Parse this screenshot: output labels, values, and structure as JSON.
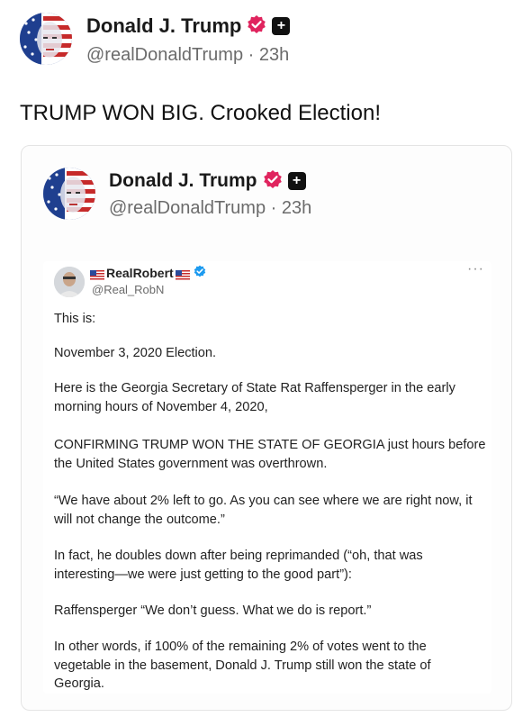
{
  "post": {
    "author_name": "Donald J. Trump",
    "handle": "@realDonaldTrump · 23h",
    "badge_glyph": "+",
    "text": "TRUMP WON BIG. Crooked Election!"
  },
  "quoted_post": {
    "author_name": "Donald J. Trump",
    "handle": "@realDonaldTrump · 23h",
    "badge_glyph": "+"
  },
  "embedded_tweet": {
    "author_name": "RealRobert",
    "handle": "@Real_RobN",
    "more_glyph": "···",
    "lines": [
      "This is:",
      "November 3, 2020 Election.",
      "Here is the Georgia Secretary of State Rat Raffensperger in the early",
      "morning hours of November 4, 2020,",
      "CONFIRMING TRUMP WON THE STATE OF GEORGIA just hours before",
      "the United States government was overthrown.",
      "“We have about 2% left to go. As you can see where we are right now, it",
      "will not change the outcome.”",
      "In fact, he doubles down after being reprimanded (“oh, that was",
      "interesting—we were just getting to the good part”):",
      "Raffensperger “We don’t guess. What we do is report.”",
      "In other words, if 100% of the remaining 2% of votes went to the",
      "vegetable in the basement, Donald J. Trump still won the state of",
      "Georgia."
    ]
  },
  "colors": {
    "verified_badge": "#e0245e",
    "blue_check": "#1d9bf0",
    "handle_gray": "#6b6b6b"
  },
  "icons": [
    "verified-badge-icon",
    "plus-badge-icon",
    "blue-check-icon",
    "us-flag-icon",
    "more-options-icon"
  ]
}
